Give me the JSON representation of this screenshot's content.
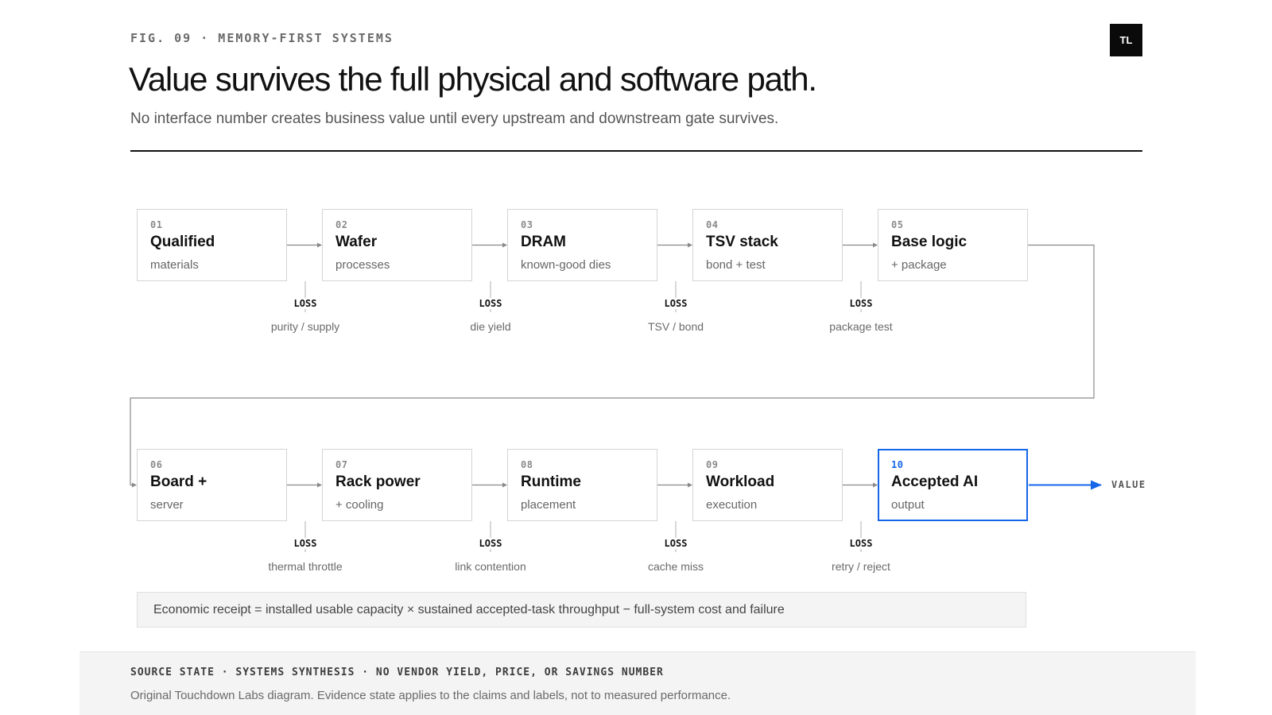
{
  "header": {
    "eyebrow": "FIG. 09 · MEMORY-FIRST SYSTEMS",
    "logo": "TL",
    "title": "Value survives the full physical and software path.",
    "subtitle": "No interface number creates business value until every upstream and downstream gate survives."
  },
  "nodes": [
    {
      "num": "01",
      "name": "Qualified",
      "sub": "materials"
    },
    {
      "num": "02",
      "name": "Wafer",
      "sub": "processes"
    },
    {
      "num": "03",
      "name": "DRAM",
      "sub": "known-good dies"
    },
    {
      "num": "04",
      "name": "TSV stack",
      "sub": "bond + test"
    },
    {
      "num": "05",
      "name": "Base logic",
      "sub": "+ package"
    },
    {
      "num": "06",
      "name": "Board +",
      "sub": "server"
    },
    {
      "num": "07",
      "name": "Rack power",
      "sub": "+ cooling"
    },
    {
      "num": "08",
      "name": "Runtime",
      "sub": "placement"
    },
    {
      "num": "09",
      "name": "Workload",
      "sub": "execution"
    },
    {
      "num": "10",
      "name": "Accepted AI",
      "sub": "output"
    }
  ],
  "losses": [
    {
      "tag": "LOSS",
      "note": "purity / supply"
    },
    {
      "tag": "LOSS",
      "note": "die yield"
    },
    {
      "tag": "LOSS",
      "note": "TSV / bond"
    },
    {
      "tag": "LOSS",
      "note": "package test"
    },
    {
      "tag": "LOSS",
      "note": "thermal throttle"
    },
    {
      "tag": "LOSS",
      "note": "link contention"
    },
    {
      "tag": "LOSS",
      "note": "cache miss"
    },
    {
      "tag": "LOSS",
      "note": "retry / reject"
    }
  ],
  "value_label": "VALUE",
  "receipt": "Economic receipt = installed usable capacity × sustained accepted-task throughput − full-system cost and failure",
  "footer": {
    "source": "SOURCE STATE · SYSTEMS SYNTHESIS · NO VENDOR YIELD, PRICE, OR SAVINGS NUMBER",
    "note": "Original Touchdown Labs diagram. Evidence state applies to the claims and labels, not to measured performance."
  },
  "colors": {
    "accent": "#1565e8",
    "ink": "#111111",
    "border": "#d4d4d4",
    "connector": "#8a8a8a"
  }
}
